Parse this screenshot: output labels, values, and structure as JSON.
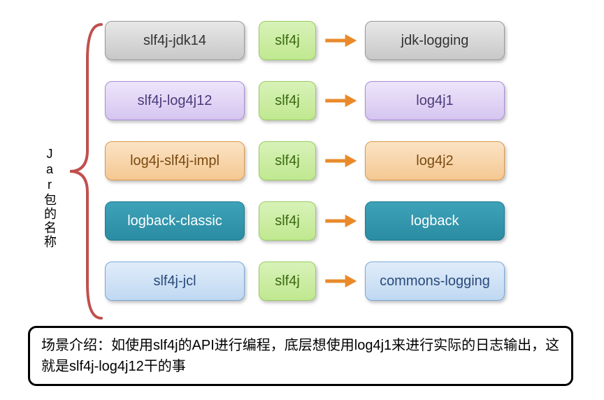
{
  "verticalLabel": "Jar包的名称",
  "rows": [
    {
      "jar": "slf4j-jdk14",
      "mid": "slf4j",
      "end": "jdk-logging",
      "jarColor": "gray",
      "endColor": "gray"
    },
    {
      "jar": "slf4j-log4j12",
      "mid": "slf4j",
      "end": "log4j1",
      "jarColor": "purple",
      "endColor": "purple"
    },
    {
      "jar": "log4j-slf4j-impl",
      "mid": "slf4j",
      "end": "log4j2",
      "jarColor": "orange",
      "endColor": "orange"
    },
    {
      "jar": "logback-classic",
      "mid": "slf4j",
      "end": "logback",
      "jarColor": "teal",
      "endColor": "teal"
    },
    {
      "jar": "slf4j-jcl",
      "mid": "slf4j",
      "end": "commons-logging",
      "jarColor": "blue",
      "endColor": "blue"
    }
  ],
  "midColor": "green",
  "arrowColor": "#e98a2a",
  "braceColor": "#c0504d",
  "caption": "场景介绍：如使用slf4j的API进行编程，底层想使用log4j1来进行实际的日志输出，这就是slf4j-log4j12干的事"
}
